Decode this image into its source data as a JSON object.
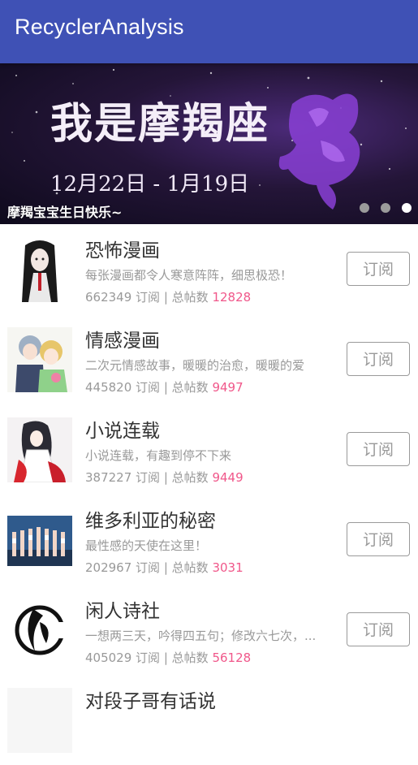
{
  "app_bar": {
    "title": "RecyclerAnalysis"
  },
  "banner": {
    "headline": "我是摩羯座",
    "dates": "12月22日 - 1月19日",
    "caption": "摩羯宝宝生日快乐~",
    "indicator": {
      "count": 3,
      "active_index": 2
    }
  },
  "list": {
    "items": [
      {
        "title": "恐怖漫画",
        "desc": "每张漫画都令人寒意阵阵，细思极恐！",
        "subscribers": "662349",
        "sub_label": "订阅",
        "posts_label": "总帖数",
        "posts": "12828",
        "button": "订阅",
        "thumb": "horror-girl"
      },
      {
        "title": "情感漫画",
        "desc": "二次元情感故事，暖暖的治愈，暖暖的爱",
        "subscribers": "445820",
        "sub_label": "订阅",
        "posts_label": "总帖数",
        "posts": "9497",
        "button": "订阅",
        "thumb": "anime-couple"
      },
      {
        "title": "小说连载",
        "desc": "小说连载，有趣到停不下来",
        "subscribers": "387227",
        "sub_label": "订阅",
        "posts_label": "总帖数",
        "posts": "9449",
        "button": "订阅",
        "thumb": "kimono-girl"
      },
      {
        "title": "维多利亚的秘密",
        "desc": "最性感的天使在这里！",
        "subscribers": "202967",
        "sub_label": "订阅",
        "posts_label": "总帖数",
        "posts": "3031",
        "button": "订阅",
        "thumb": "runway"
      },
      {
        "title": "闲人诗社",
        "desc": "一想两三天，吟得四五句；修改六七次，...",
        "subscribers": "405029",
        "sub_label": "订阅",
        "posts_label": "总帖数",
        "posts": "56128",
        "button": "订阅",
        "thumb": "ink-logo"
      },
      {
        "title": "对段子哥有话说",
        "desc": "",
        "subscribers": "",
        "sub_label": "",
        "posts_label": "",
        "posts": "",
        "button": "",
        "thumb": "partial"
      }
    ]
  },
  "colors": {
    "app_bar": "#3F51B5",
    "post_count": "#f0578a",
    "secondary_text": "#999999",
    "title_text": "#333333"
  }
}
